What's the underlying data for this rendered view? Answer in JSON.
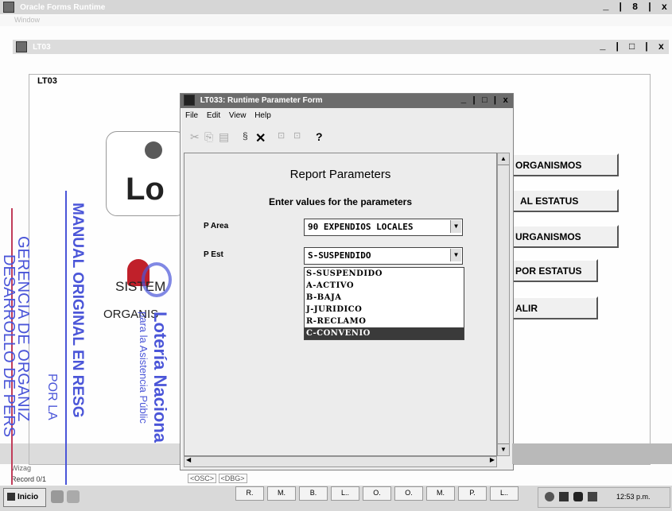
{
  "outer_window": {
    "title": "Oracle Forms Runtime",
    "controls": "_ | 8 | x",
    "menu": "Window"
  },
  "inner_window": {
    "title": "LT03",
    "controls": "_ | □ | x",
    "panel_label": "LT03"
  },
  "left_app": {
    "logo_text": "Lo",
    "sistema_text": "SISTEM",
    "organis_text": "ORGANIS"
  },
  "side_buttons": [
    "ORGANISMOS",
    "AL ESTATUS",
    "URGANISMOS",
    "POR ESTATUS",
    "ALIR"
  ],
  "dialog": {
    "title": "LT033: Runtime Parameter Form",
    "controls": "_ | □ | x",
    "menu": [
      "File",
      "Edit",
      "View",
      "Help"
    ],
    "heading": "Report Parameters",
    "subheading": "Enter values for the parameters",
    "p_area_label": "P Area",
    "p_area_value": "90 EXPENDIOS LOCALES",
    "p_est_label": "P Est",
    "p_est_value": "S-SUSPENDIDO",
    "p_est_options": [
      "S-SUSPENDIDO",
      "A-ACTIVO",
      "B-BAJA",
      "J-JURIDICO",
      "R-RECLAMO",
      "C-CONVENIO"
    ],
    "selected_index": 5,
    "status_chips": [
      "<OSC>",
      "<DBG>"
    ]
  },
  "status_bar": {
    "line1": "Wizag",
    "line2": "Record 0/1"
  },
  "stamp": {
    "line1": "MANUAL ORIGINAL EN RESG",
    "line2": "GERENCIA DE ORGANIZ",
    "line3": "DESARROLLO DE PERS",
    "line4": "POR LA",
    "brand": "Lotería Naciona",
    "brand_sub": "para la Asistencia Públic"
  },
  "taskbar": {
    "start_label": "Inicio",
    "buttons": [
      "R.",
      "M.",
      "B.",
      "L..",
      "O.",
      "O.",
      "M.",
      "P.",
      "L.."
    ],
    "clock": "12:53 p.m."
  },
  "colors": {
    "selection": "#3a3a3a",
    "stamp": "#4a55d8",
    "logo_red": "#c0202a"
  }
}
